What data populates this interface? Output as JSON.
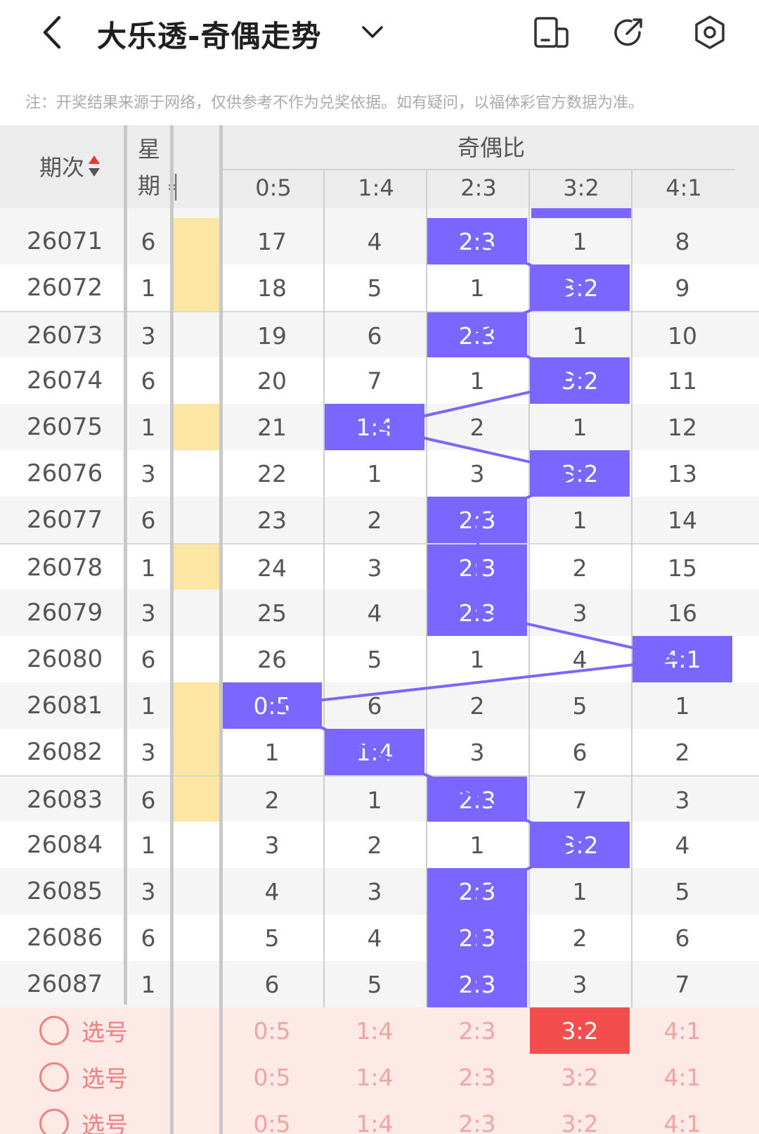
{
  "header": {
    "title": "大乐透-奇偶走势",
    "back_icon": "chevron-left-icon",
    "dropdown_icon": "chevron-down-icon",
    "action_icons": [
      "phone-layout-icon",
      "share-icon",
      "settings-icon"
    ]
  },
  "notice": "注：开奖结果来源于网络，仅供参考不作为兑奖依据。如有疑问，以福体彩官方数据为准。",
  "table": {
    "col_issue": "期次",
    "col_week": "星期",
    "group_title": "奇偶比",
    "ratio_headers": [
      "0:5",
      "1:4",
      "2:3",
      "3:2",
      "4:1"
    ],
    "rows": [
      {
        "issue": "26071",
        "week": "6",
        "cells": [
          "17",
          "4",
          "2:3",
          "1",
          "8"
        ],
        "hit": 2
      },
      {
        "issue": "26072",
        "week": "1",
        "cells": [
          "18",
          "5",
          "1",
          "3:2",
          "9"
        ],
        "hit": 3
      },
      {
        "issue": "26073",
        "week": "3",
        "cells": [
          "19",
          "6",
          "2:3",
          "1",
          "10"
        ],
        "hit": 2
      },
      {
        "issue": "26074",
        "week": "6",
        "cells": [
          "20",
          "7",
          "1",
          "3:2",
          "11"
        ],
        "hit": 3
      },
      {
        "issue": "26075",
        "week": "1",
        "cells": [
          "21",
          "1:4",
          "2",
          "1",
          "12"
        ],
        "hit": 1
      },
      {
        "issue": "26076",
        "week": "3",
        "cells": [
          "22",
          "1",
          "3",
          "3:2",
          "13"
        ],
        "hit": 3
      },
      {
        "issue": "26077",
        "week": "6",
        "cells": [
          "23",
          "2",
          "2:3",
          "1",
          "14"
        ],
        "hit": 2
      },
      {
        "issue": "26078",
        "week": "1",
        "cells": [
          "24",
          "3",
          "2:3",
          "2",
          "15"
        ],
        "hit": 2
      },
      {
        "issue": "26079",
        "week": "3",
        "cells": [
          "25",
          "4",
          "2:3",
          "3",
          "16"
        ],
        "hit": 2
      },
      {
        "issue": "26080",
        "week": "6",
        "cells": [
          "26",
          "5",
          "1",
          "4",
          "4:1"
        ],
        "hit": 4
      },
      {
        "issue": "26081",
        "week": "1",
        "cells": [
          "0:5",
          "6",
          "2",
          "5",
          "1"
        ],
        "hit": 0
      },
      {
        "issue": "26082",
        "week": "3",
        "cells": [
          "1",
          "1:4",
          "3",
          "6",
          "2"
        ],
        "hit": 1
      },
      {
        "issue": "26083",
        "week": "6",
        "cells": [
          "2",
          "1",
          "2:3",
          "7",
          "3"
        ],
        "hit": 2
      },
      {
        "issue": "26084",
        "week": "1",
        "cells": [
          "3",
          "2",
          "1",
          "3:2",
          "4"
        ],
        "hit": 3
      },
      {
        "issue": "26085",
        "week": "3",
        "cells": [
          "4",
          "3",
          "2:3",
          "1",
          "5"
        ],
        "hit": 2
      },
      {
        "issue": "26086",
        "week": "6",
        "cells": [
          "5",
          "4",
          "2:3",
          "2",
          "6"
        ],
        "hit": 2
      },
      {
        "issue": "26087",
        "week": "1",
        "cells": [
          "6",
          "5",
          "2:3",
          "3",
          "7"
        ],
        "hit": 2
      }
    ],
    "yellow_rows": [
      0,
      1,
      4,
      7,
      10,
      11,
      12
    ],
    "pick_label": "选号",
    "pick_rows": [
      {
        "selected": 3
      },
      {
        "selected": -1
      },
      {
        "selected": -1
      }
    ]
  },
  "colors": {
    "hit": "#7b66ff",
    "selected": "#f24e4e",
    "pick_text": "#f2a3a3",
    "pick_bg": "#fde9e5",
    "hidden_col": "#fde6a4"
  }
}
